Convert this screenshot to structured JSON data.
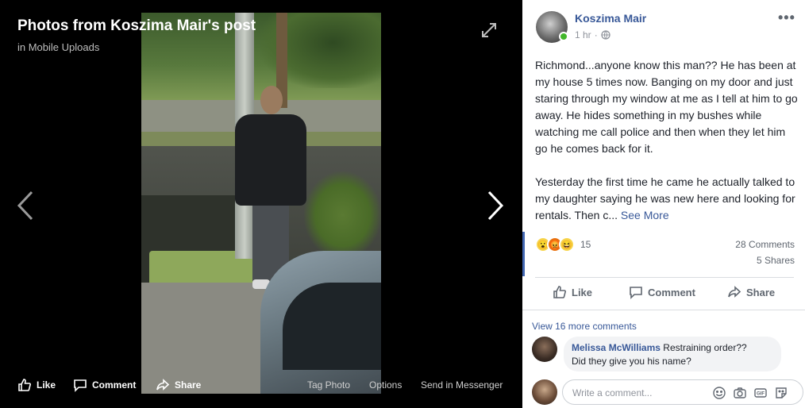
{
  "viewer": {
    "title": "Photos from Koszima Mair's post",
    "subtitle": "in Mobile Uploads",
    "bottom_bar": {
      "like": "Like",
      "comment": "Comment",
      "share": "Share",
      "tag_photo": "Tag Photo",
      "options": "Options",
      "send_in_messenger": "Send in Messenger"
    },
    "icons": [
      "expand-icon",
      "chevron-left-icon",
      "chevron-right-icon"
    ]
  },
  "post": {
    "author": "Koszima Mair",
    "time": "1 hr",
    "more_glyph": "•••",
    "paragraphs": [
      "Richmond...anyone know this man?? He has been at my house 5 times now. Banging on my door and just staring through my window at me as I tell at him to go away. He hides something in my bushes while watching me call police and then when they let him go he comes back for it.",
      "Yesterday the first time he came he actually talked to my daughter saying he was new here and looking for rentals. Then c..."
    ],
    "see_more": "See More",
    "reactions": {
      "count": "15",
      "types": [
        "wow",
        "angry",
        "haha"
      ]
    },
    "comments_count": "28 Comments",
    "shares_count": "5 Shares",
    "actions": {
      "like": "Like",
      "comment": "Comment",
      "share": "Share"
    }
  },
  "comments": {
    "view_more": "View 16 more comments",
    "items": [
      {
        "author": "Melissa McWilliams",
        "text": "Restraining order??",
        "text2": "Did they give you his name?"
      }
    ],
    "composer_placeholder": "Write a comment..."
  },
  "colors": {
    "link_blue": "#385898",
    "accent_blue": "#4267b2",
    "online_green": "#42b72a"
  }
}
